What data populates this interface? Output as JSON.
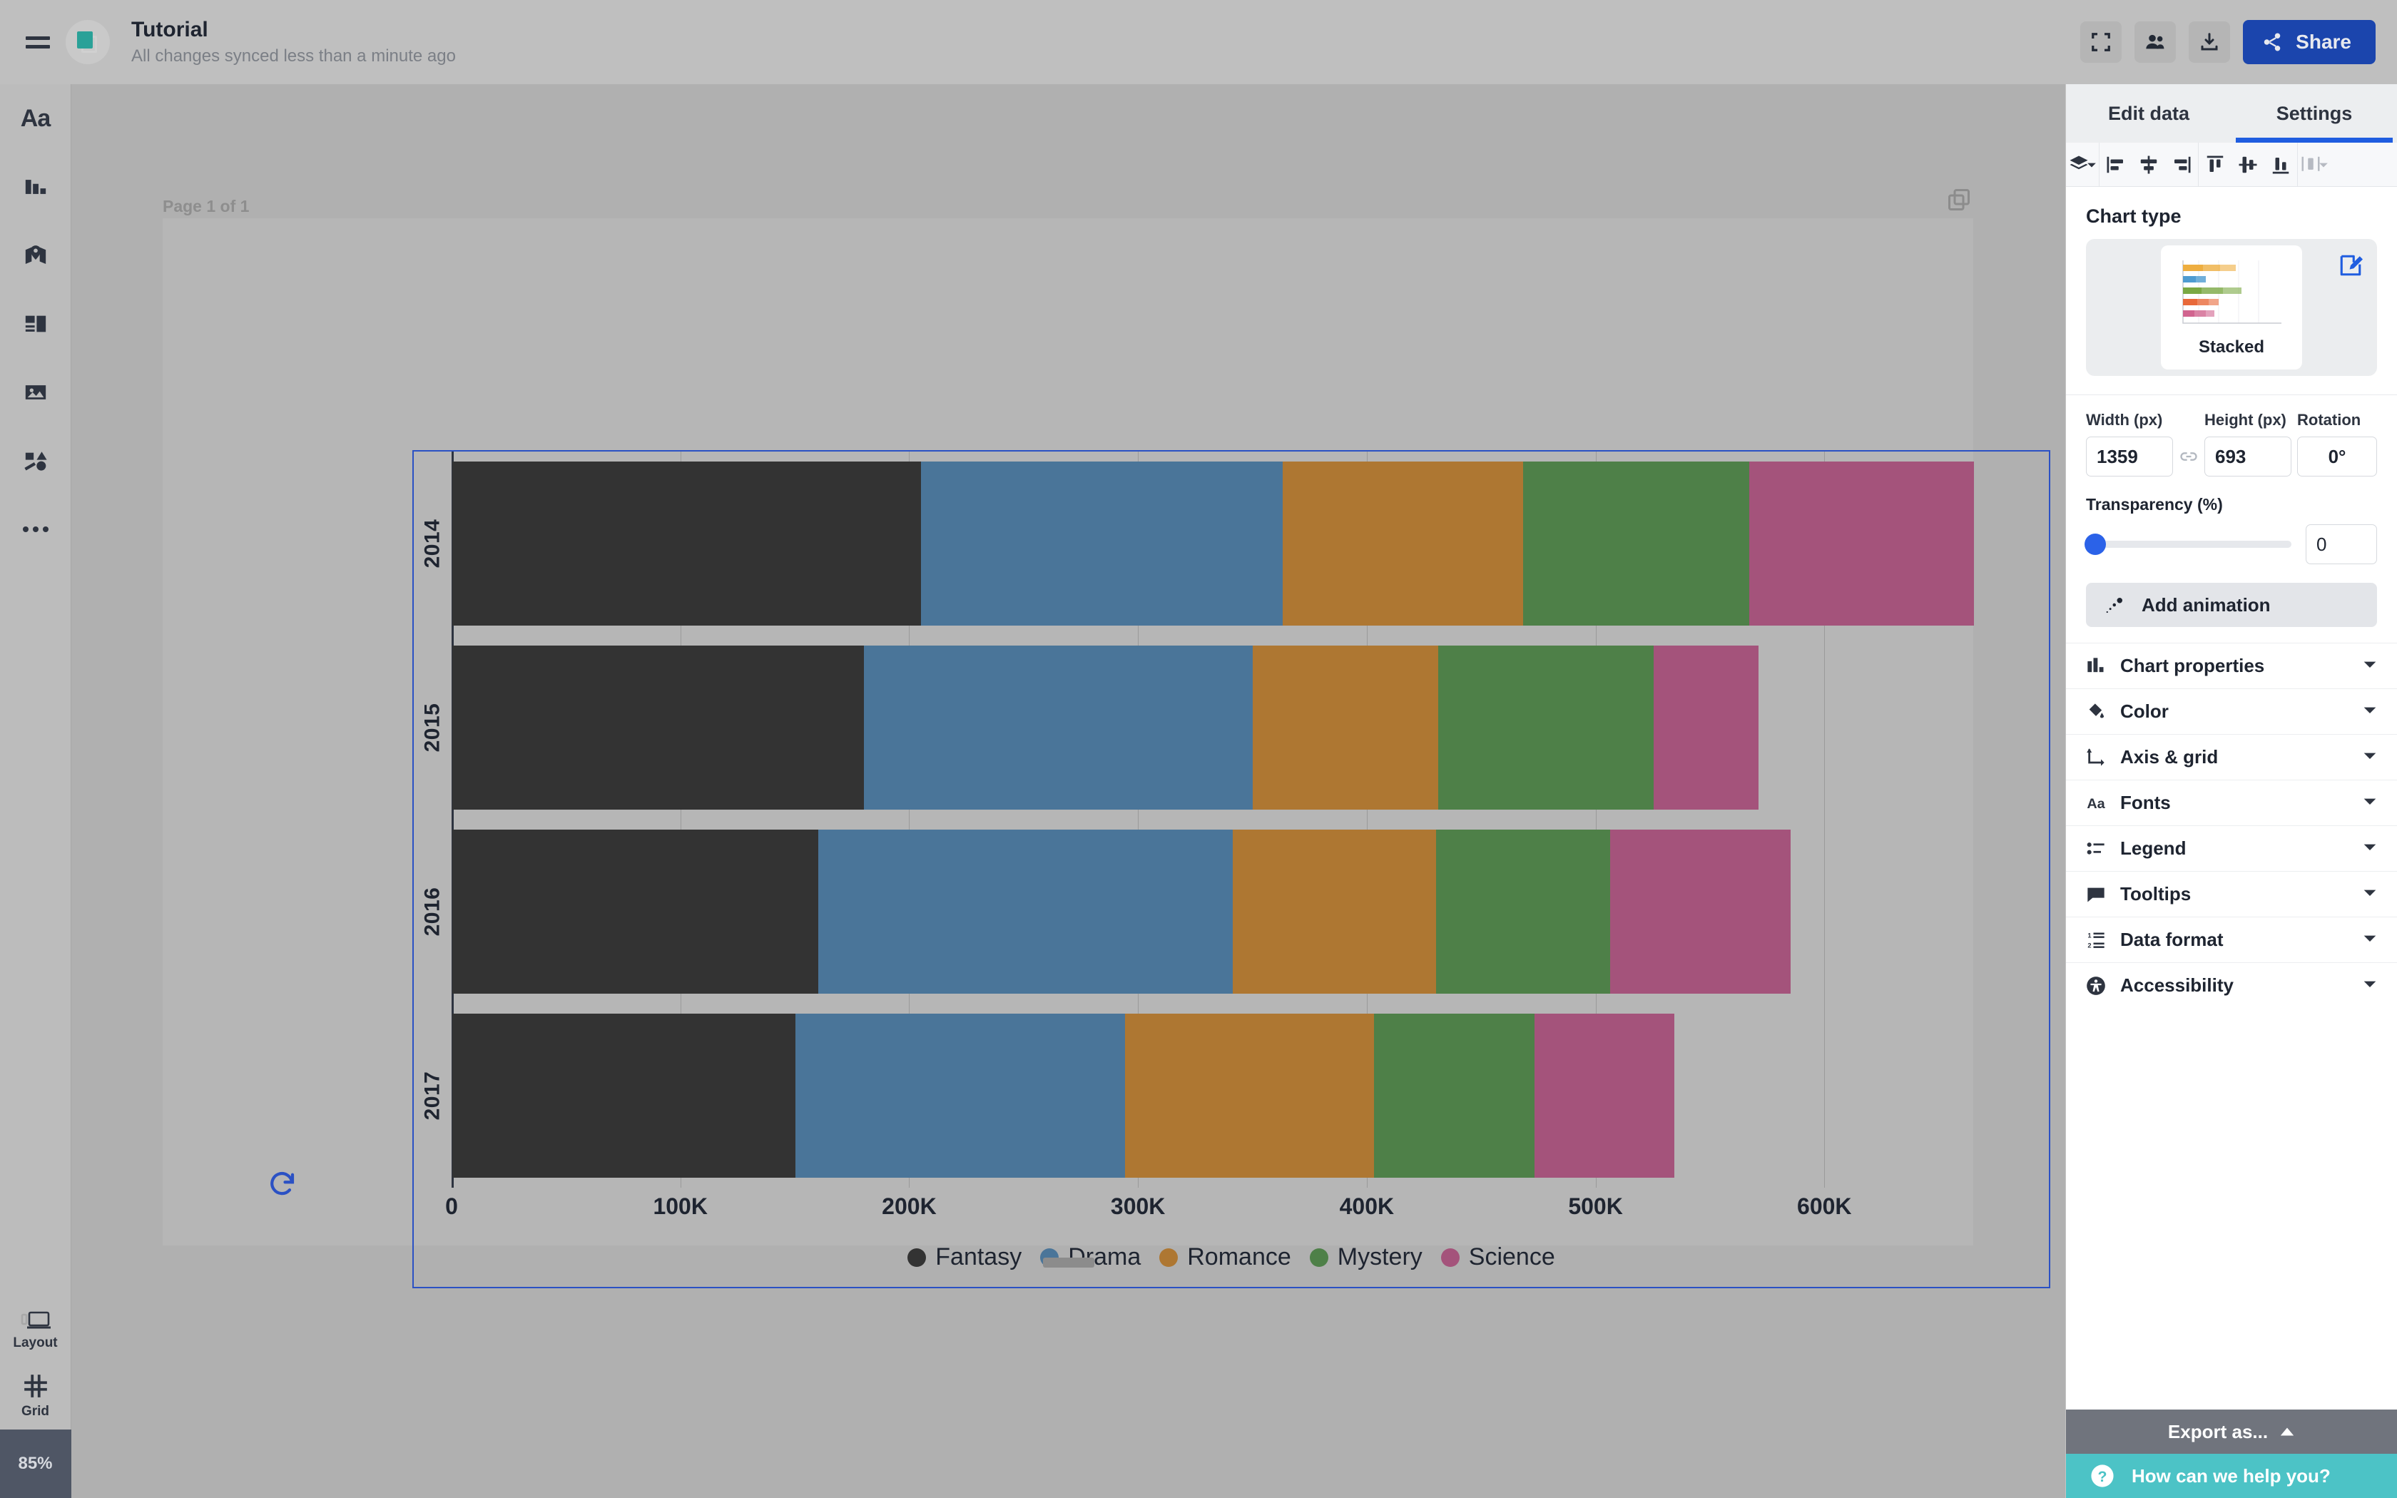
{
  "topbar": {
    "menu_icon": "hamburger-icon",
    "doc_icon": "pages-icon",
    "title": "Tutorial",
    "subtitle": "All changes synced less than a minute ago",
    "actions": [
      {
        "name": "fullscreen-button",
        "icon": "fullscreen-icon"
      },
      {
        "name": "collaborators-button",
        "icon": "people-icon"
      },
      {
        "name": "download-button",
        "icon": "download-icon"
      }
    ],
    "share_label": "Share",
    "share_icon": "share-icon",
    "share_color": "#1b45ad"
  },
  "sidebar": {
    "items": [
      {
        "name": "sidebar-item-text",
        "icon": "text-icon",
        "glyph": "Aa"
      },
      {
        "name": "sidebar-item-chart",
        "icon": "bar-chart-icon"
      },
      {
        "name": "sidebar-item-map",
        "icon": "map-pin-icon"
      },
      {
        "name": "sidebar-item-layout",
        "icon": "layout-blocks-icon"
      },
      {
        "name": "sidebar-item-image",
        "icon": "image-icon"
      },
      {
        "name": "sidebar-item-shapes",
        "icon": "shapes-icon"
      },
      {
        "name": "sidebar-item-more",
        "icon": "ellipsis-icon"
      }
    ],
    "tools": [
      {
        "name": "layout-tool",
        "icon": "device-layout-icon",
        "label": "Layout"
      },
      {
        "name": "grid-tool",
        "icon": "grid-icon",
        "label": "Grid"
      }
    ],
    "zoom_level": "85%"
  },
  "canvas": {
    "page_label": "Page 1 of 1",
    "duplicate_icon": "duplicate-icon",
    "refresh_icon": "refresh-icon",
    "resize_handle": "slide-resize-handle"
  },
  "panel": {
    "tabs": [
      {
        "name": "tab-edit-data",
        "label": "Edit data",
        "active": false
      },
      {
        "name": "tab-settings",
        "label": "Settings",
        "active": true
      }
    ],
    "active_underline_color": "#1f5de0",
    "align_tools": [
      {
        "name": "arrange-layers-button",
        "icon": "layers-icon",
        "caret": true,
        "dim": false
      },
      {
        "name": "align-left-button",
        "icon": "align-left-icon",
        "dim": false
      },
      {
        "name": "align-center-horizontal-button",
        "icon": "align-center-horizontal-icon",
        "dim": false
      },
      {
        "name": "align-right-button",
        "icon": "align-right-icon",
        "dim": false
      },
      {
        "name": "align-top-button",
        "icon": "align-top-icon",
        "dim": false
      },
      {
        "name": "align-middle-button",
        "icon": "align-middle-icon",
        "dim": false
      },
      {
        "name": "align-bottom-button",
        "icon": "align-bottom-icon",
        "dim": false
      },
      {
        "name": "distribute-button",
        "icon": "distribute-icon",
        "caret": true,
        "dim": true
      }
    ],
    "chart_type": {
      "heading": "Chart type",
      "selected": "Stacked",
      "edit_icon": "edit-chart-icon",
      "thumb_colors": [
        "#eeae40",
        "#4e9bd1",
        "#7aa843",
        "#e8693a",
        "#d1648f"
      ]
    },
    "dimensions": {
      "width_label": "Width (px)",
      "width_value": "1359",
      "link_icon": "link-icon",
      "height_label": "Height (px)",
      "height_value": "693",
      "rotation_label": "Rotation",
      "rotation_value": "0°"
    },
    "transparency": {
      "label": "Transparency (%)",
      "value": "0",
      "slider_percent": 0,
      "accent": "#2b62e8"
    },
    "animation": {
      "icon": "animation-icon",
      "label": "Add animation"
    },
    "accordions": [
      {
        "name": "accordion-chart-properties",
        "icon": "bar-chart-icon",
        "label": "Chart properties"
      },
      {
        "name": "accordion-color",
        "icon": "paint-bucket-icon",
        "label": "Color"
      },
      {
        "name": "accordion-axis-grid",
        "icon": "axis-icon",
        "label": "Axis & grid"
      },
      {
        "name": "accordion-fonts",
        "icon": "font-icon",
        "label": "Fonts"
      },
      {
        "name": "accordion-legend",
        "icon": "legend-icon",
        "label": "Legend"
      },
      {
        "name": "accordion-tooltips",
        "icon": "tooltip-icon",
        "label": "Tooltips"
      },
      {
        "name": "accordion-data-format",
        "icon": "numbered-list-icon",
        "label": "Data format"
      },
      {
        "name": "accordion-accessibility",
        "icon": "accessibility-icon",
        "label": "Accessibility"
      }
    ],
    "export_label": "Export as...",
    "export_caret": "caret-up-icon",
    "help_label": "How can we help you?",
    "help_icon": "question-mark-icon"
  },
  "chart_data": {
    "type": "bar",
    "orientation": "horizontal",
    "stacked": true,
    "title": "",
    "xlabel": "",
    "ylabel": "",
    "categories": [
      "2014",
      "2015",
      "2016",
      "2017"
    ],
    "xlim": [
      0,
      700000
    ],
    "xticks": [
      0,
      100000,
      200000,
      300000,
      400000,
      500000,
      600000
    ],
    "xticklabels": [
      "0",
      "100K",
      "200K",
      "300K",
      "400K",
      "500K",
      "600K"
    ],
    "grid": true,
    "legend_position": "bottom",
    "series": [
      {
        "name": "Fantasy",
        "color": "#333333",
        "values": [
          205000,
          180000,
          160000,
          150000
        ]
      },
      {
        "name": "Drama",
        "color": "#4a7599",
        "values": [
          158000,
          170000,
          181000,
          144000
        ]
      },
      {
        "name": "Romance",
        "color": "#ae7732",
        "values": [
          105000,
          81000,
          89000,
          109000
        ]
      },
      {
        "name": "Mystery",
        "color": "#4e8048",
        "values": [
          99000,
          94000,
          76000,
          70000
        ]
      },
      {
        "name": "Science",
        "color": "#a4537b",
        "values": [
          98000,
          46000,
          79000,
          61000
        ]
      }
    ],
    "totals": [
      665000,
      571000,
      585000,
      534000
    ]
  }
}
